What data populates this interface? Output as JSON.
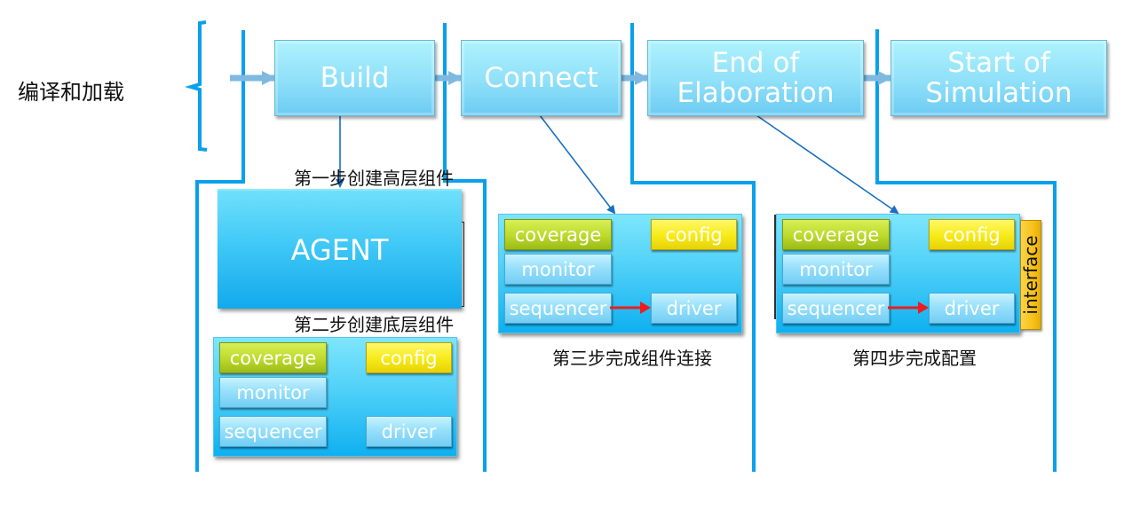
{
  "side_label": "编译和加载",
  "phases": [
    {
      "id": "build",
      "label": "Build"
    },
    {
      "id": "connect",
      "label": "Connect"
    },
    {
      "id": "end-of-elaboration",
      "label": "End of\nElaboration"
    },
    {
      "id": "start-of-simulation",
      "label": "Start of\nSimulation"
    }
  ],
  "steps": {
    "step1": "第一步创建高层组件",
    "step2": "第二步创建底层组件",
    "step3": "第三步完成组件连接",
    "step4": "第四步完成配置"
  },
  "agent_label": "AGENT",
  "components": {
    "coverage": "coverage",
    "config": "config",
    "monitor": "monitor",
    "sequencer": "sequencer",
    "driver": "driver",
    "interface": "interface"
  },
  "colors": {
    "boundary_line": "#0aa0ec",
    "pointer_arrow": "#1a6fc0",
    "connection_arrow": "#ee1c1c",
    "flow_arrow": "#7fb9e0"
  }
}
